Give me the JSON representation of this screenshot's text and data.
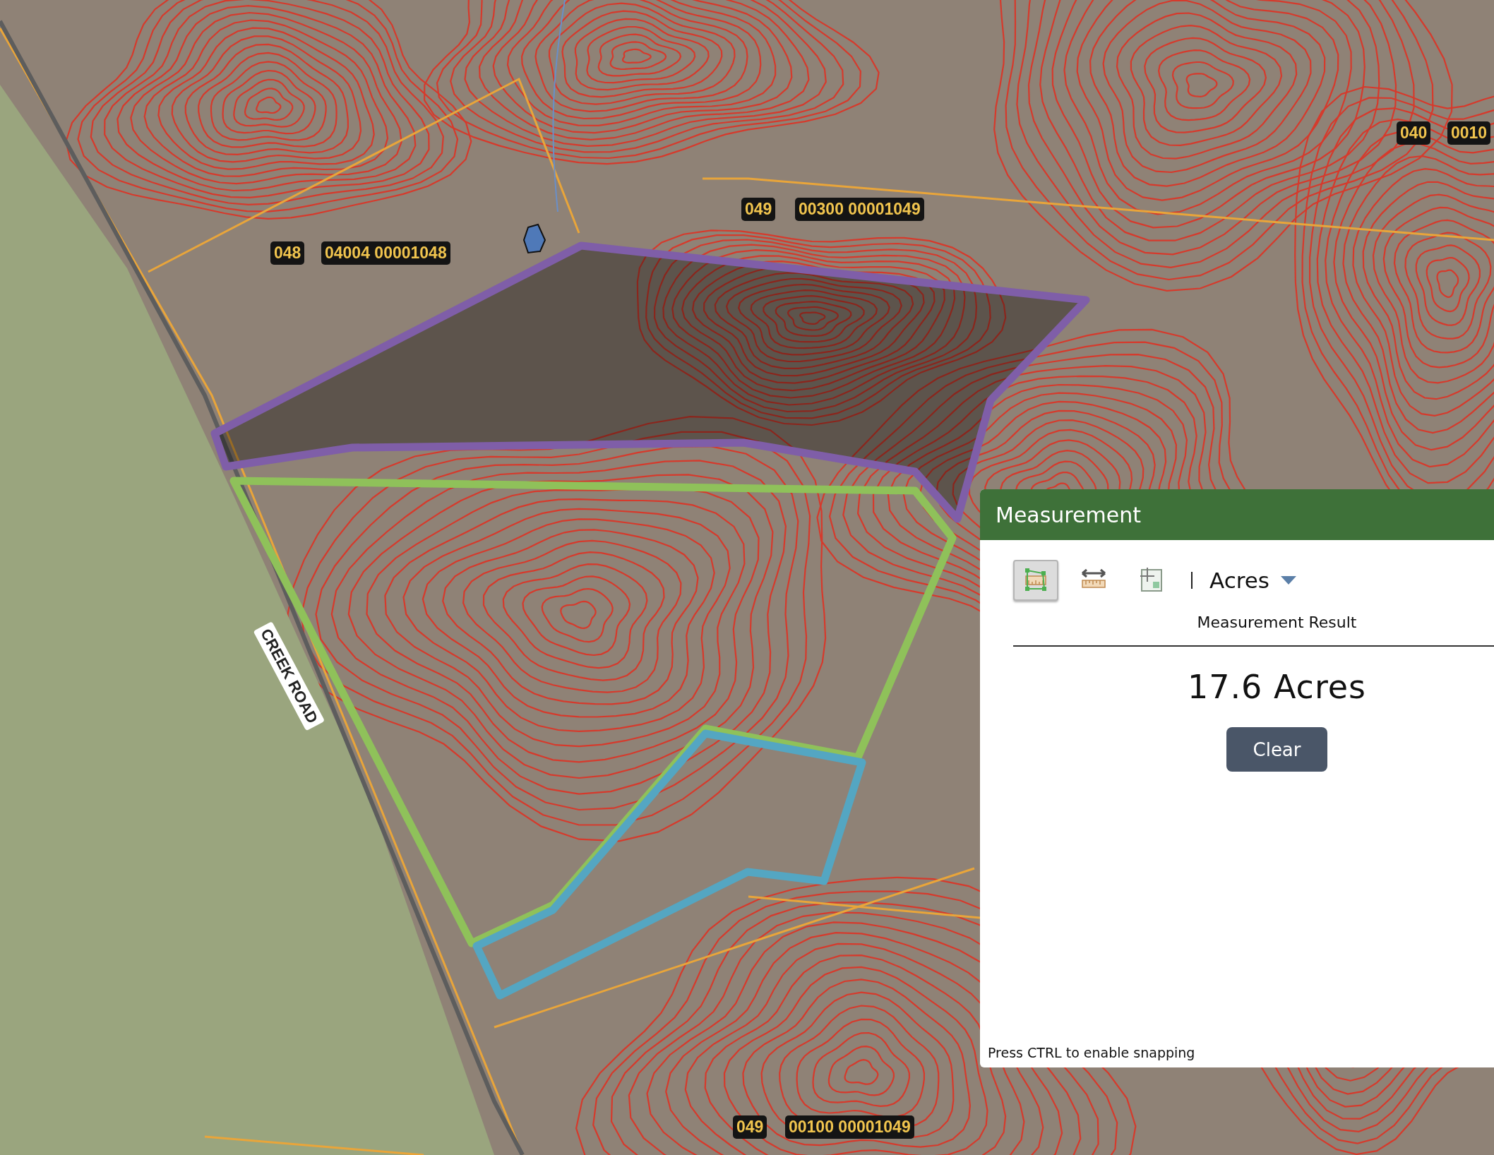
{
  "map": {
    "labels": [
      {
        "kind": "parcel",
        "text": "048"
      },
      {
        "kind": "parcel",
        "text": "04004 00001048"
      },
      {
        "kind": "parcel",
        "text": "049"
      },
      {
        "kind": "parcel",
        "text": "00300 00001049"
      },
      {
        "kind": "parcel",
        "text": "040"
      },
      {
        "kind": "parcel",
        "text": "0010"
      },
      {
        "kind": "road",
        "text": "CREEK ROAD"
      },
      {
        "kind": "parcel",
        "text": "049"
      },
      {
        "kind": "parcel",
        "text": "00100 00001049"
      }
    ],
    "shapes": [
      {
        "kind": "outline",
        "color": "#7f5ea8"
      },
      {
        "kind": "outline",
        "color": "#8fc15a"
      },
      {
        "kind": "outline",
        "color": "#54a6c2"
      }
    ]
  },
  "panel": {
    "title": "Measurement",
    "tools": [
      {
        "kind": "area",
        "selected": true
      },
      {
        "kind": "distance",
        "selected": false
      },
      {
        "kind": "location",
        "selected": false
      }
    ],
    "unit": "Acres",
    "result_heading": "Measurement Result",
    "result": "17.6 Acres",
    "button": "Clear",
    "hint": "Press CTRL to enable snapping"
  }
}
